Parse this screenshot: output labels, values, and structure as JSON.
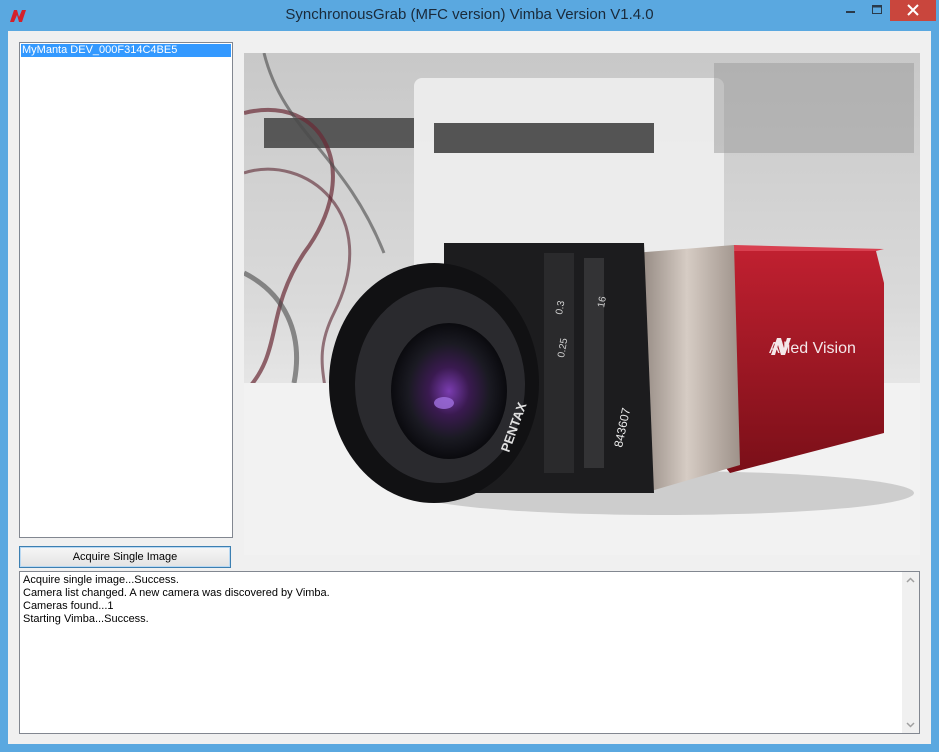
{
  "window": {
    "title": "SynchronousGrab (MFC version) Vimba Version V1.4.0",
    "accent_color": "#5aa8e0",
    "close_color": "#c9463d",
    "icons": [
      "allied-vision-logo-icon",
      "minimize-icon",
      "maximize-icon",
      "close-icon"
    ]
  },
  "camera_list": {
    "items": [
      "MyManta DEV_000F314C4BE5"
    ],
    "selected_color": "#3399ff"
  },
  "acquire_button": {
    "label": "Acquire Single Image"
  },
  "preview": {
    "brand_text": "Allied Vision",
    "lens_brand": "PENTAX",
    "lens_marks": [
      "0.25",
      "0.3",
      "16",
      "843607"
    ]
  },
  "log": {
    "lines": [
      "Acquire single image...Success.",
      "Camera list changed. A new camera was discovered by Vimba.",
      "Cameras found...1",
      "Starting Vimba...Success."
    ]
  }
}
